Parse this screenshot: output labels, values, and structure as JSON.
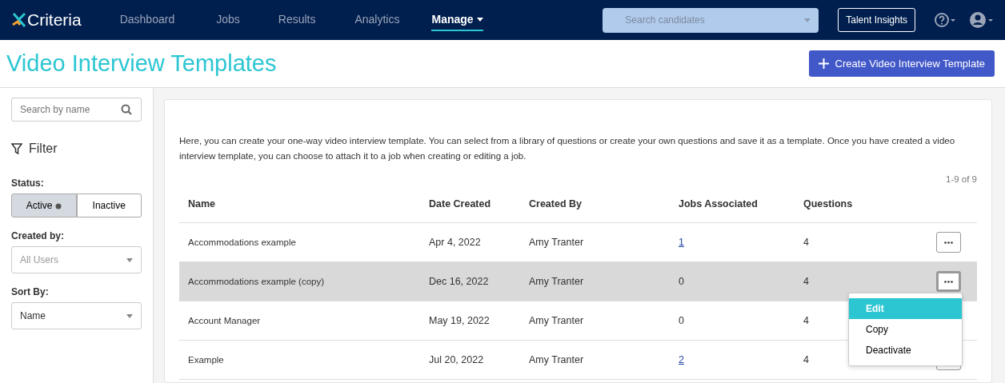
{
  "navbar": {
    "logo": "Criteria",
    "items": [
      {
        "label": "Dashboard",
        "selected": false,
        "dropdown": false
      },
      {
        "label": "Jobs",
        "selected": false,
        "dropdown": false
      },
      {
        "label": "Results",
        "selected": false,
        "dropdown": false
      },
      {
        "label": "Analytics",
        "selected": false,
        "dropdown": false
      },
      {
        "label": "Manage",
        "selected": true,
        "dropdown": true
      }
    ],
    "search": {
      "placeholder": "Search candidates"
    },
    "insights_button": "Talent Insights"
  },
  "page_title": "Video Interview Templates",
  "create_button": "Create Video Interview Template",
  "sidebar": {
    "search": {
      "placeholder": "Search by name"
    },
    "filter_title": "Filter",
    "status_label": "Status:",
    "status_options": [
      {
        "label": "Active",
        "selected": true
      },
      {
        "label": "Inactive",
        "selected": false
      }
    ],
    "created_by_label": "Created by:",
    "created_by": {
      "placeholder": "All Users"
    },
    "sort_label": "Sort By:",
    "sort_by": "Name"
  },
  "intro": "Here, you can create your one-way video interview template. You can select from a library of questions or create your own questions and save it as a template. Once you have created a video interview template, you can choose to attach it to a job when creating or editing a job.",
  "count": "1-9 of 9",
  "table": {
    "columns": [
      "Name",
      "Date Created",
      "Created By",
      "Jobs Associated",
      "Questions"
    ],
    "rows": [
      {
        "name": "Accommodations example",
        "date": "Apr 4, 2022",
        "created_by": "Amy Tranter",
        "jobs": "1",
        "jobs_link": true,
        "questions": "4",
        "selected": false
      },
      {
        "name": "Accommodations example (copy)",
        "date": "Dec 16, 2022",
        "created_by": "Amy Tranter",
        "jobs": "0",
        "jobs_link": false,
        "questions": "4",
        "selected": true
      },
      {
        "name": "Account Manager",
        "date": "May 19, 2022",
        "created_by": "Amy Tranter",
        "jobs": "0",
        "jobs_link": false,
        "questions": "4",
        "selected": false
      },
      {
        "name": "Example",
        "date": "Jul 20, 2022",
        "created_by": "Amy Tranter",
        "jobs": "2",
        "jobs_link": true,
        "questions": "4",
        "selected": false
      }
    ]
  },
  "menu": {
    "items": [
      {
        "label": "Edit",
        "selected": true
      },
      {
        "label": "Copy",
        "selected": false
      },
      {
        "label": "Deactivate",
        "selected": false
      }
    ]
  }
}
